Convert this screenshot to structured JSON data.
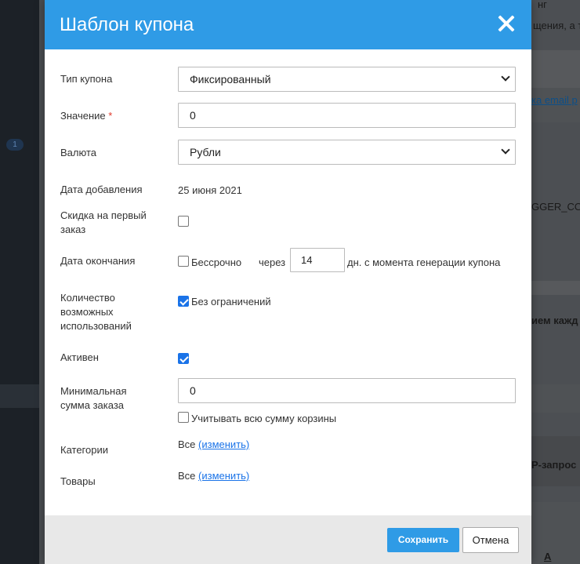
{
  "background": {
    "badge": "1",
    "right_texts": [
      "нг",
      "щения, а т",
      "ка email р",
      "GGER_COU",
      "ием кажд",
      "Р-запрос",
      "A"
    ]
  },
  "modal": {
    "title": "Шаблон купона",
    "coupon_type": {
      "label": "Тип купона",
      "value": "Фиксированный"
    },
    "value": {
      "label": "Значение",
      "required_mark": "*",
      "value": "0"
    },
    "currency": {
      "label": "Валюта",
      "value": "Рубли"
    },
    "date_added": {
      "label": "Дата добавления",
      "value": "25 июня 2021"
    },
    "first_order_discount": {
      "label": "Скидка на первый заказ",
      "checked": false
    },
    "end_date": {
      "label": "Дата окончания",
      "unlimited_label": "Бессрочно",
      "unlimited_checked": false,
      "after_label": "через",
      "days_value": "14",
      "suffix": "дн. с момента генерации купона"
    },
    "usage_count": {
      "label": "Количество возможных использований",
      "unlimited_label": "Без ограничений",
      "unlimited_checked": true
    },
    "active": {
      "label": "Активен",
      "checked": true
    },
    "min_order_sum": {
      "label": "Минимальная сумма заказа",
      "value": "0",
      "whole_cart_label": "Учитывать всю сумму корзины",
      "whole_cart_checked": false
    },
    "categories": {
      "label": "Категории",
      "value": "Все",
      "change_link": "(изменить)"
    },
    "products": {
      "label": "Товары",
      "value": "Все",
      "change_link": "(изменить)"
    },
    "footer": {
      "save_label": "Сохранить",
      "cancel_label": "Отмена"
    }
  },
  "colors": {
    "accent": "#2f9be6",
    "checkbox_checked": "#1a73e8",
    "required": "#e0392b"
  }
}
